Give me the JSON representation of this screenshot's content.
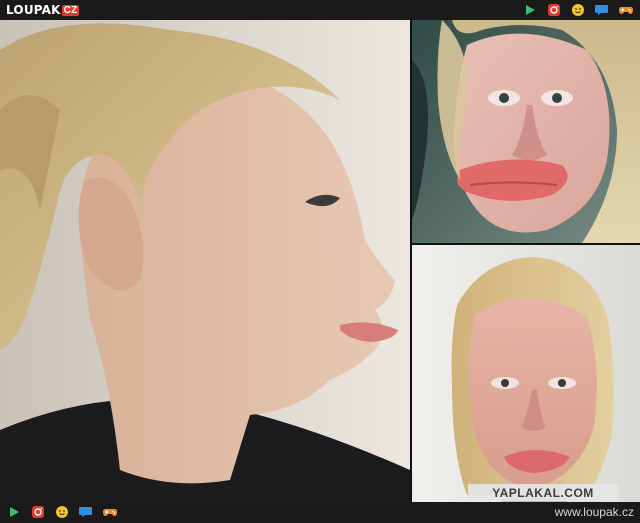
{
  "brand": {
    "name": "LOUPAK",
    "tld": "CZ"
  },
  "footer": {
    "url": "www.loupak.cz"
  },
  "watermark": "YAPLAKAL.COM",
  "icons": {
    "top": [
      "play-icon",
      "instagram-icon",
      "smiley-icon",
      "chat-icon",
      "gamepad-icon"
    ],
    "bottom": [
      "play-icon",
      "instagram-icon",
      "smiley-icon",
      "chat-icon",
      "gamepad-icon"
    ]
  },
  "photos": [
    {
      "name": "photo-left-profile",
      "subject": "woman profile with swollen upper lip"
    },
    {
      "name": "photo-top-right",
      "subject": "woman with severely swollen lips"
    },
    {
      "name": "photo-bottom-right",
      "subject": "woman with swollen face and lips"
    }
  ],
  "colors": {
    "accent_red": "#e03a2f",
    "play_green": "#38c172",
    "chat_blue": "#2f8fe0",
    "smiley_yellow": "#f3c623",
    "gamepad_orange": "#f08a24"
  }
}
